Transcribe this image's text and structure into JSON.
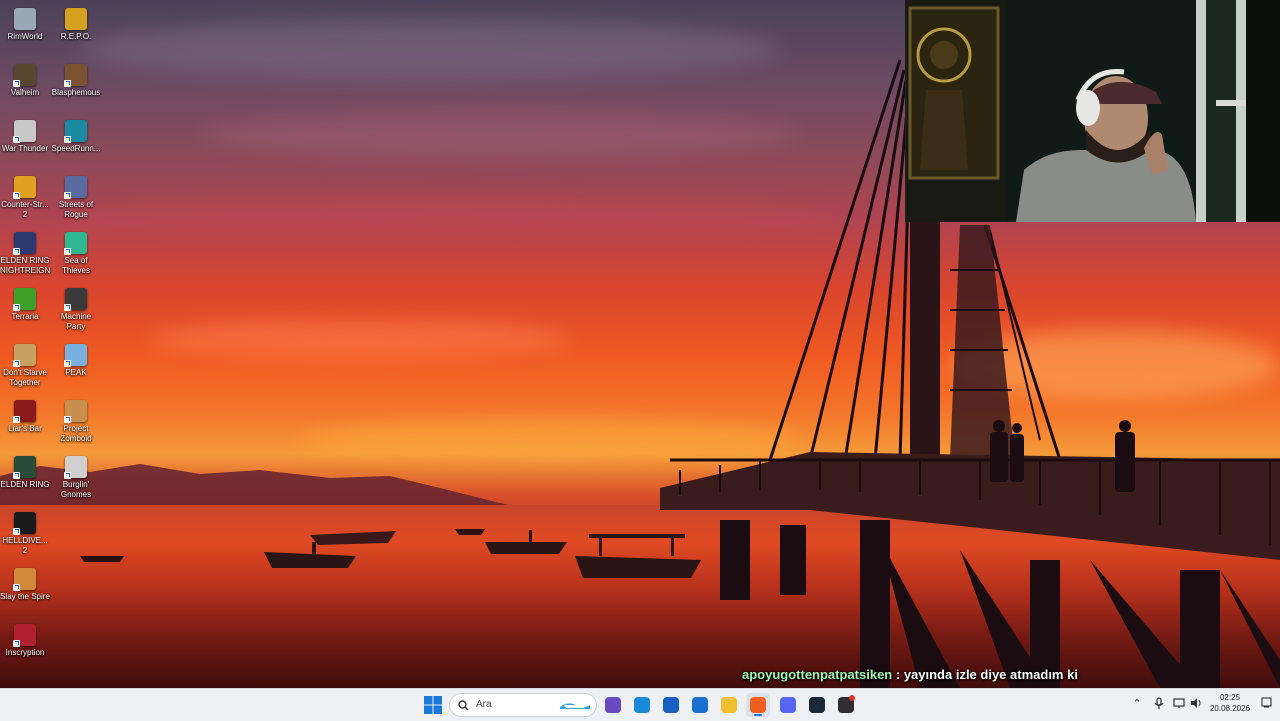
{
  "desktop": {
    "icons": [
      {
        "label": "RimWorld",
        "icon": "rimworld-icon",
        "color": "#9aa7b5",
        "shortcut": false
      },
      {
        "label": "R.E.P.O.",
        "icon": "repo-icon",
        "color": "#d6a020",
        "shortcut": false
      },
      {
        "label": "Valheim",
        "icon": "valheim-icon",
        "color": "#5a4530",
        "shortcut": true
      },
      {
        "label": "Blasphemous",
        "icon": "blasphemous-icon",
        "color": "#7a5230",
        "shortcut": true
      },
      {
        "label": "War Thunder",
        "icon": "war-thunder-icon",
        "color": "#c9c9c9",
        "shortcut": true
      },
      {
        "label": "SpeedRunn...",
        "icon": "speedrunners-icon",
        "color": "#1a8aa0",
        "shortcut": true
      },
      {
        "label": "Counter-Str... 2",
        "icon": "counter-strike-icon",
        "color": "#e0a020",
        "shortcut": true
      },
      {
        "label": "Streets of Rogue",
        "icon": "streets-of-rogue-icon",
        "color": "#5a6aa0",
        "shortcut": true
      },
      {
        "label": "ELDEN RING NIGHTREIGN",
        "icon": "elden-ring-nightreign-icon",
        "color": "#2a3a70",
        "shortcut": true
      },
      {
        "label": "Sea of Thieves",
        "icon": "sea-of-thieves-icon",
        "color": "#2fb890",
        "shortcut": true
      },
      {
        "label": "Terraria",
        "icon": "terraria-icon",
        "color": "#3fa02a",
        "shortcut": true
      },
      {
        "label": "Machine Party",
        "icon": "machine-party-icon",
        "color": "#3a3a3a",
        "shortcut": true
      },
      {
        "label": "Don't Starve Together",
        "icon": "dont-starve-together-icon",
        "color": "#c8a060",
        "shortcut": true
      },
      {
        "label": "PEAK",
        "icon": "peak-icon",
        "color": "#7ab0e0",
        "shortcut": true
      },
      {
        "label": "Liar's Bar",
        "icon": "liars-bar-icon",
        "color": "#8a1a1a",
        "shortcut": true
      },
      {
        "label": "Project Zomboid",
        "icon": "project-zomboid-icon",
        "color": "#c89050",
        "shortcut": true
      },
      {
        "label": "ELDEN RING",
        "icon": "elden-ring-icon",
        "color": "#2a4a3a",
        "shortcut": true
      },
      {
        "label": "Burglin' Gnomes",
        "icon": "burglin-gnomes-icon",
        "color": "#d0d0d0",
        "shortcut": true
      },
      {
        "label": "HELLDIVE... 2",
        "icon": "helldivers-icon",
        "color": "#1a1a1a",
        "shortcut": true
      },
      {
        "label": "Slay the Spire",
        "icon": "slay-the-spire-icon",
        "color": "#d08a3a",
        "shortcut": true
      },
      {
        "label": "Inscryption",
        "icon": "inscryption-icon",
        "color": "#b02030",
        "shortcut": true
      }
    ]
  },
  "chat": {
    "username": "apoyugottenpatpatsiken",
    "separator": " : ",
    "message": "yayında izle diye atmadım ki"
  },
  "taskbar": {
    "search_placeholder": "Ara",
    "pinned": [
      {
        "name": "widgets-icon",
        "color": "#6a4ac0"
      },
      {
        "name": "edge-icon",
        "color": "#1a8ad8"
      },
      {
        "name": "store-icon",
        "color": "#1560c0"
      },
      {
        "name": "mail-icon",
        "color": "#1a70d0"
      },
      {
        "name": "file-explorer-icon",
        "color": "#f0c030"
      },
      {
        "name": "firefox-icon",
        "color": "#f06020"
      },
      {
        "name": "discord-icon",
        "color": "#5865f2"
      },
      {
        "name": "steam-icon",
        "color": "#1b2838"
      },
      {
        "name": "obs-icon",
        "color": "#302e31"
      }
    ],
    "time": "02:25",
    "date": "20.08.2026"
  }
}
